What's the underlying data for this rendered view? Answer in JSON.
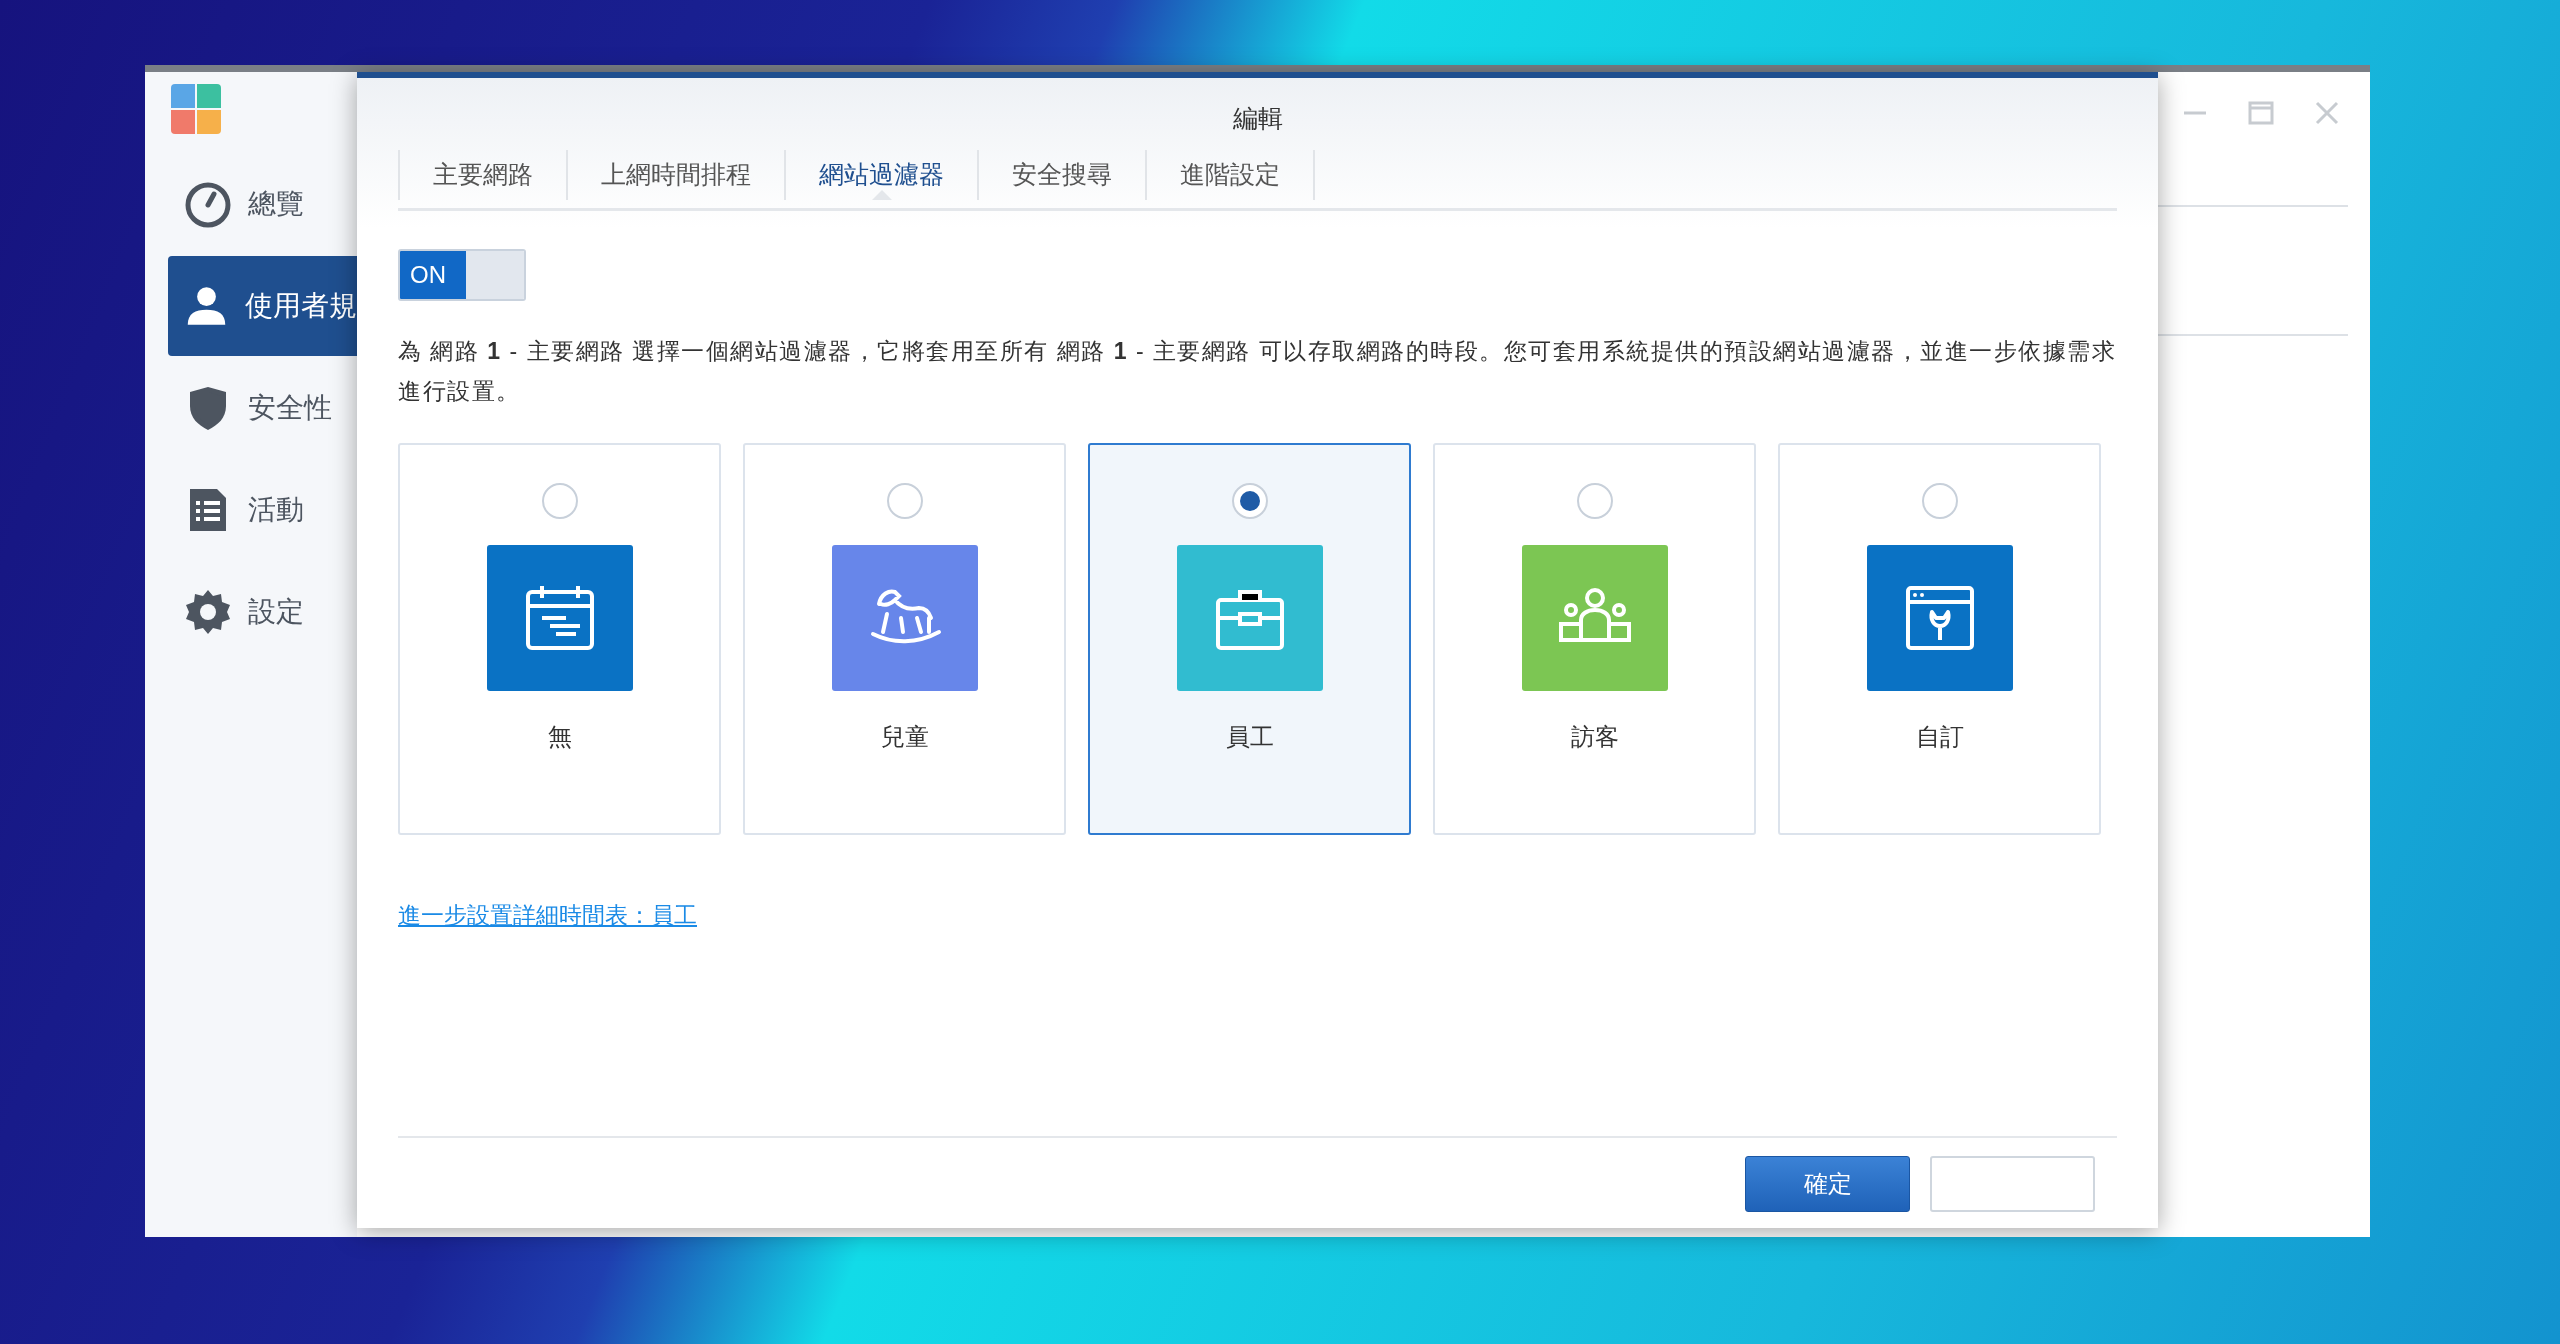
{
  "sidebar": {
    "items": [
      {
        "label": "總覽",
        "selected": false
      },
      {
        "label": "使用者規",
        "selected": true
      },
      {
        "label": "安全性",
        "selected": false
      },
      {
        "label": "活動",
        "selected": false
      },
      {
        "label": "設定",
        "selected": false
      }
    ]
  },
  "dialog": {
    "title": "編輯",
    "tabs": [
      {
        "label": "主要網路",
        "selected": false
      },
      {
        "label": "上網時間排程",
        "selected": false
      },
      {
        "label": "網站過濾器",
        "selected": true
      },
      {
        "label": "安全搜尋",
        "selected": false
      },
      {
        "label": "進階設定",
        "selected": false
      }
    ],
    "toggle": {
      "label": "ON",
      "on": true
    },
    "description": "為 網路 **1** - 主要網路 選擇一個網站過濾器，它將套用至所有 網路 **1** - 主要網路 可以存取網路的時段。您可套用系統提供的預設網站過濾器，並進一步依據需求進行設置。",
    "filters": [
      {
        "label": "無",
        "selected": false,
        "color": "#0a72c4"
      },
      {
        "label": "兒童",
        "selected": false,
        "color": "#6786ea"
      },
      {
        "label": "員工",
        "selected": true,
        "color": "#31bcd0"
      },
      {
        "label": "訪客",
        "selected": false,
        "color": "#7cc653"
      },
      {
        "label": "自訂",
        "selected": false,
        "color": "#0a72c4"
      }
    ],
    "link": "進一步設置詳細時間表：員工",
    "buttons": [
      {
        "kind": "primary",
        "label": "確定"
      },
      {
        "kind": "secondary"
      }
    ]
  }
}
